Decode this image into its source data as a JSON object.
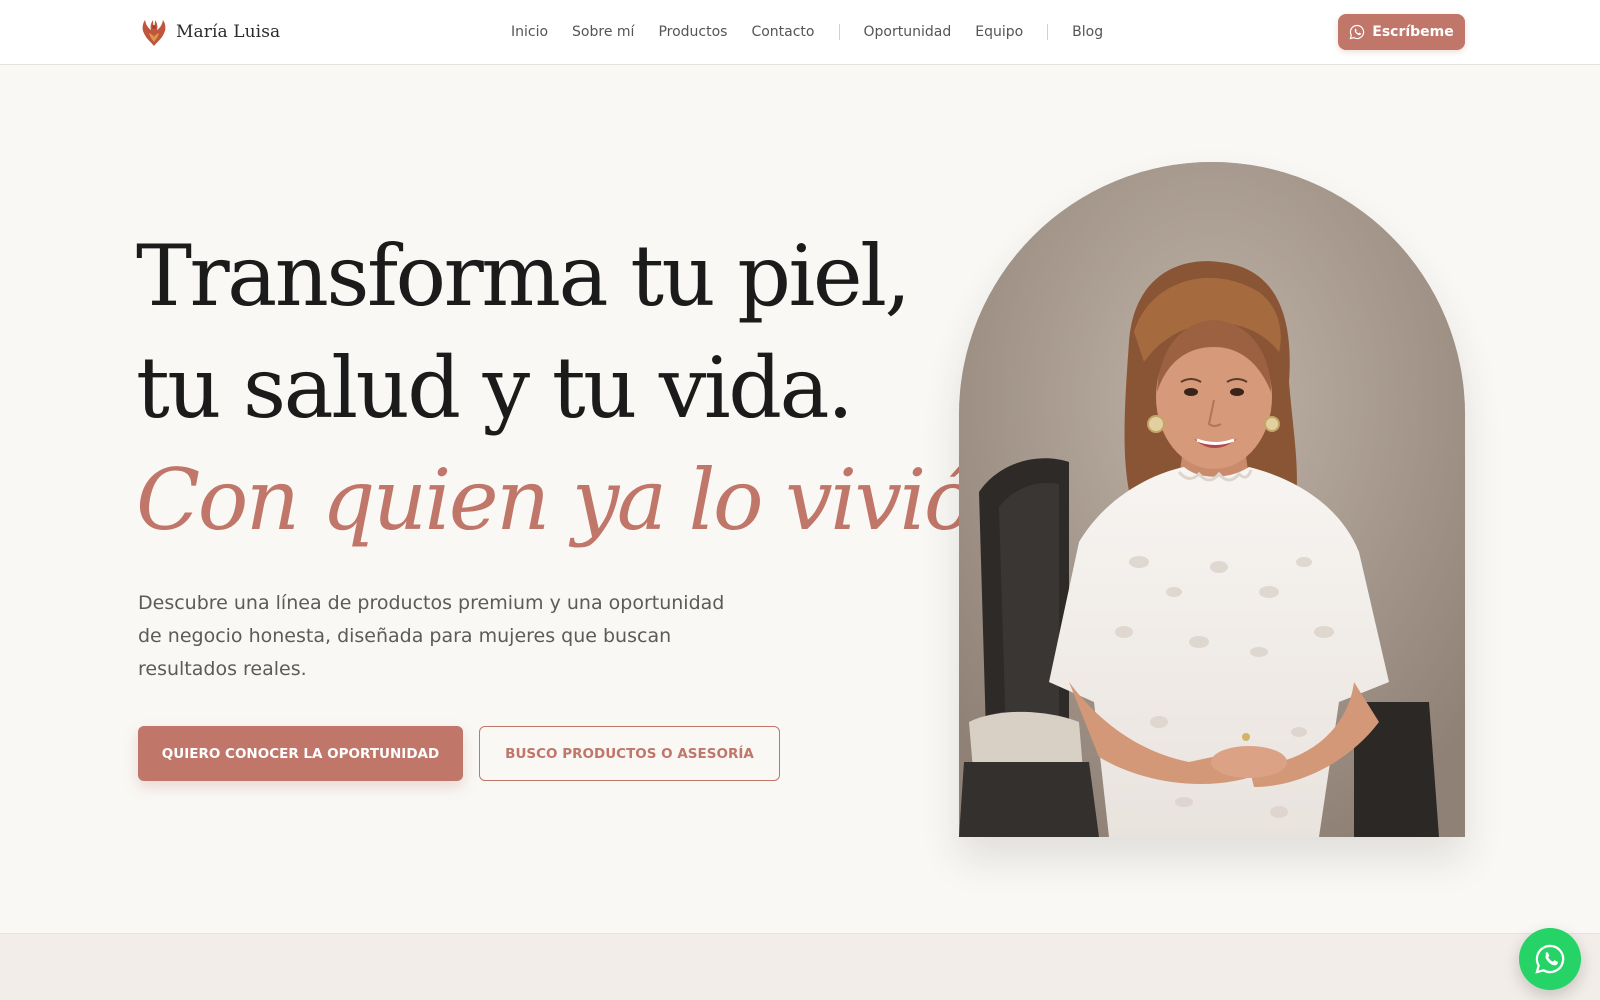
{
  "brand": {
    "name": "María Luisa",
    "logo_icon": "phoenix-logo-icon",
    "accent_color": "#c07669"
  },
  "nav": {
    "items": [
      "Inicio",
      "Sobre mí",
      "Productos",
      "Contacto",
      "Oportunidad",
      "Equipo",
      "Blog"
    ],
    "cta_label": "Escríbeme",
    "cta_icon": "whatsapp-icon"
  },
  "hero": {
    "title_line1": "Transforma tu piel,",
    "title_line2": "tu salud y tu vida.",
    "title_accent": "Con quien ya lo vivió.",
    "description": "Descubre una línea de productos premium y una oportunidad de negocio honesta, diseñada para mujeres que buscan resultados reales.",
    "primary_button": "QUIERO CONOCER LA OPORTUNIDAD",
    "secondary_button": "BUSCO PRODUCTOS O ASESORÍA",
    "image": "portrait-photo"
  },
  "floating": {
    "icon": "whatsapp-icon",
    "color": "#25d366"
  }
}
